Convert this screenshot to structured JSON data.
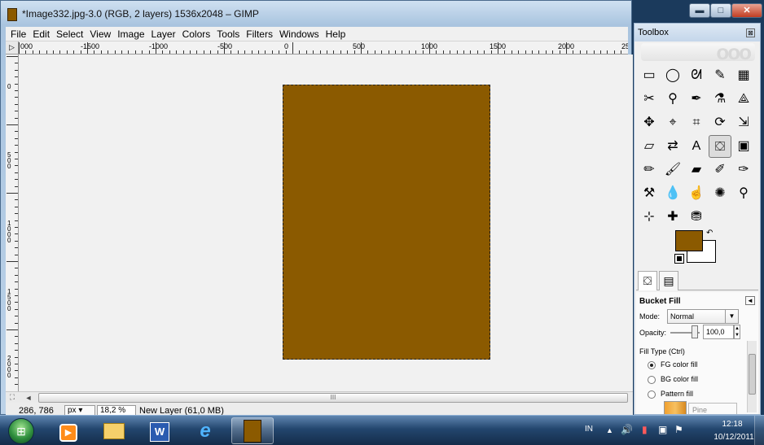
{
  "window": {
    "title": "*Image332.jpg-3.0 (RGB, 2 layers) 1536x2048 – GIMP",
    "controls": {
      "minimize": "▬",
      "maximize": "□",
      "close": "✕"
    }
  },
  "menu": [
    "File",
    "Edit",
    "Select",
    "View",
    "Image",
    "Layer",
    "Colors",
    "Tools",
    "Filters",
    "Windows",
    "Help"
  ],
  "hruler": {
    "corner_glyph": "▷",
    "labels": [
      "000",
      "-1500",
      "-1000",
      "-500",
      "0",
      "500",
      "1000",
      "1500",
      "2000",
      "25"
    ]
  },
  "vruler": {
    "labels": [
      "0",
      "500",
      "1000",
      "1500",
      "2000"
    ]
  },
  "canvas": {
    "fill_color": "#8b5a00",
    "background_color": "#f1f1f1"
  },
  "scrollbar": {
    "nav_glyph": "⛶",
    "left_arrow": "◄",
    "grip": "III"
  },
  "status": {
    "coords": "286, 786",
    "unit": "px",
    "zoom": "18,2 %",
    "message": "New Layer (61,0 MB)"
  },
  "toolbox": {
    "title": "Toolbox",
    "close_glyph": "⊠",
    "banner": "ooo",
    "tools": [
      {
        "name": "rect-select",
        "glyph": "▭"
      },
      {
        "name": "ellipse-select",
        "glyph": "◯"
      },
      {
        "name": "free-select",
        "glyph": "ᘛ"
      },
      {
        "name": "fuzzy-select",
        "glyph": "✎"
      },
      {
        "name": "color-select",
        "glyph": "▦"
      },
      {
        "name": "scissors",
        "glyph": "✂"
      },
      {
        "name": "foreground-select",
        "glyph": "⚲"
      },
      {
        "name": "paths",
        "glyph": "✒"
      },
      {
        "name": "color-picker",
        "glyph": "⚗"
      },
      {
        "name": "zoom-measure",
        "glyph": "⟁"
      },
      {
        "name": "move",
        "glyph": "✥"
      },
      {
        "name": "align",
        "glyph": "⌖"
      },
      {
        "name": "crop",
        "glyph": "⌗"
      },
      {
        "name": "rotate",
        "glyph": "⟳"
      },
      {
        "name": "scale",
        "glyph": "⇲"
      },
      {
        "name": "shear",
        "glyph": "▱"
      },
      {
        "name": "perspective",
        "glyph": "⇄"
      },
      {
        "name": "text",
        "glyph": "A"
      },
      {
        "name": "bucket-fill",
        "glyph": "⛋"
      },
      {
        "name": "blend",
        "glyph": "▣"
      },
      {
        "name": "pencil",
        "glyph": "✏"
      },
      {
        "name": "paintbrush",
        "glyph": "🖌"
      },
      {
        "name": "eraser",
        "glyph": "▰"
      },
      {
        "name": "airbrush",
        "glyph": "✐"
      },
      {
        "name": "ink",
        "glyph": "✑"
      },
      {
        "name": "clone",
        "glyph": "⚒"
      },
      {
        "name": "blur",
        "glyph": "💧"
      },
      {
        "name": "smudge",
        "glyph": "☝"
      },
      {
        "name": "dodge-burn",
        "glyph": "✺"
      },
      {
        "name": "magnify",
        "glyph": "⚲"
      },
      {
        "name": "cage-transform",
        "glyph": "⊹"
      },
      {
        "name": "heal",
        "glyph": "✚"
      },
      {
        "name": "perspective-clone",
        "glyph": "⛃"
      }
    ],
    "colors": {
      "fg": "#8b5a00",
      "bg": "#ffffff",
      "swap_glyph": "↶"
    },
    "tabs": {
      "tool_options_glyph": "⛋",
      "layers_glyph": "▤"
    },
    "tool_options": {
      "title": "Bucket Fill",
      "menu_glyph": "◄",
      "mode_label": "Mode:",
      "mode_value": "Normal",
      "opacity_label": "Opacity:",
      "opacity_value": "100,0",
      "opacity": 1.0,
      "fill_type_label": "Fill Type  (Ctrl)",
      "fill_types": [
        {
          "label": "FG color fill",
          "selected": true
        },
        {
          "label": "BG color fill",
          "selected": false
        },
        {
          "label": "Pattern fill",
          "selected": false
        }
      ],
      "pattern_name": "Pine"
    }
  },
  "taskbar": {
    "start_glyph": "⊞",
    "tasks": [
      {
        "name": "media-player",
        "glyph": "▶"
      },
      {
        "name": "explorer",
        "glyph": ""
      },
      {
        "name": "word",
        "glyph": "W"
      },
      {
        "name": "internet-explorer",
        "glyph": "e"
      },
      {
        "name": "gimp",
        "glyph": ""
      }
    ],
    "tray": {
      "lang": "IN",
      "up_glyph": "▲",
      "volume_glyph": "🔊",
      "network_glyph": "▮",
      "flag_glyph": "⚑",
      "time": "12:18",
      "date": "10/12/2011"
    }
  }
}
